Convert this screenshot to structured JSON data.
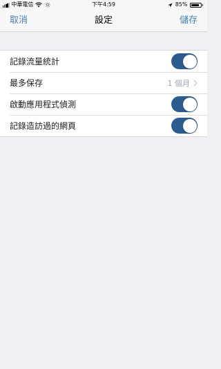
{
  "status_bar": {
    "carrier": "中華電信",
    "time": "下午4:59",
    "battery_percent_text": "85%",
    "battery_level": 0.85,
    "icons": [
      "signal-icon",
      "wifi-icon",
      "brightness-icon",
      "location-arrow-icon",
      "battery-icon"
    ]
  },
  "nav": {
    "cancel_label": "取消",
    "title": "設定",
    "save_label": "儲存",
    "accent_color": "#4d80b5"
  },
  "settings": {
    "rows": [
      {
        "label": "記錄流量統計",
        "control": "toggle",
        "on": true
      },
      {
        "label": "最多保存",
        "control": "disclosure",
        "value": "1 個月"
      },
      {
        "label": "啟動應用程式偵測",
        "control": "toggle",
        "on": true
      },
      {
        "label": "記錄造訪過的網頁",
        "control": "toggle",
        "on": true
      }
    ],
    "toggle_on_color": "#2d5b8e"
  }
}
